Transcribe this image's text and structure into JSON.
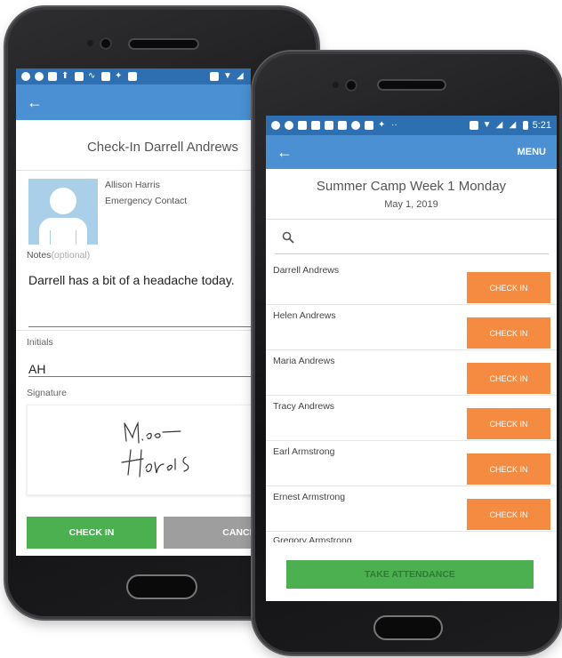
{
  "colors": {
    "appbar": "#4a90d2",
    "statusbar": "#2d6fb0",
    "checkin_green": "#4caf50",
    "checkin_orange": "#f58b40",
    "cancel_gray": "#9e9e9e"
  },
  "left_phone": {
    "header": {
      "back_icon": "arrow-left-icon"
    },
    "title": "Check-In Darrell Andrews",
    "contact": {
      "name": "Allison Harris",
      "role": "Emergency Contact",
      "avatar_icon": "person-silhouette-icon"
    },
    "notes_label": "Notes",
    "notes_optional": "(optional)",
    "notes_value": "Darrell has a bit of a headache today.",
    "initials_label": "Initials",
    "initials_value": "AH",
    "signature_label": "Signature",
    "signature_value": "Allison Harris",
    "checkin_button": "CHECK IN",
    "cancel_button": "CANCEL"
  },
  "right_phone": {
    "status": {
      "time": "5:21"
    },
    "header": {
      "back_icon": "arrow-left-icon",
      "menu_label": "MENU"
    },
    "title": "Summer Camp Week 1 Monday",
    "date": "May 1, 2019",
    "search_icon": "search-icon",
    "checkin_label": "CHECK IN",
    "list": [
      {
        "name": "Darrell Andrews"
      },
      {
        "name": "Helen Andrews"
      },
      {
        "name": "Maria Andrews"
      },
      {
        "name": "Tracy Andrews"
      },
      {
        "name": "Earl Armstrong"
      },
      {
        "name": "Ernest Armstrong"
      },
      {
        "name": "Gregory Armstrong"
      }
    ],
    "take_attendance": "TAKE ATTENDANCE"
  }
}
